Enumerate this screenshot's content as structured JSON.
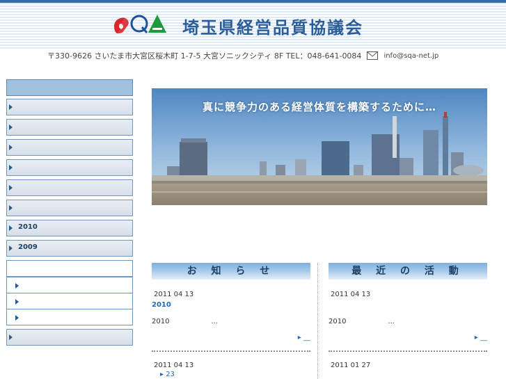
{
  "header": {
    "title": "埼玉県経営品質協議会",
    "address": "〒330-9626 さいたま市大宮区桜木町 1-7-5 大宮ソニックシティ 8F TEL：048-641-0084",
    "email": "info@sqa-net.jp"
  },
  "colors": {
    "accent": "#2f6ea5",
    "link": "#1f6ab0",
    "title": "#2a5d9a"
  },
  "sidebar": {
    "items": [
      {
        "label": ""
      },
      {
        "label": ""
      },
      {
        "label": ""
      },
      {
        "label": ""
      },
      {
        "label": ""
      },
      {
        "label": ""
      },
      {
        "label": "2010"
      },
      {
        "label": "2009"
      }
    ],
    "sub_items": [
      {
        "label": ""
      },
      {
        "label": ""
      },
      {
        "label": ""
      }
    ],
    "last_item": {
      "label": ""
    }
  },
  "hero": {
    "caption": "真に競争力のある経営体質を構築するために…"
  },
  "news": {
    "heading": "お 知 ら せ",
    "entry1": {
      "date": "2011 04 13",
      "title": "2010",
      "body_year": "2010",
      "body_tail": "..."
    },
    "more": "▸ __",
    "entry2": {
      "date": "2011 04 13",
      "title": "▸ 23"
    }
  },
  "activities": {
    "heading": "最 近 の 活 動",
    "entry1": {
      "date": "2011 04 13",
      "title": "",
      "body_year": "2010",
      "body_tail": "..."
    },
    "more": "▸ __",
    "entry2": {
      "date": "2011 01 27",
      "title": ""
    }
  }
}
